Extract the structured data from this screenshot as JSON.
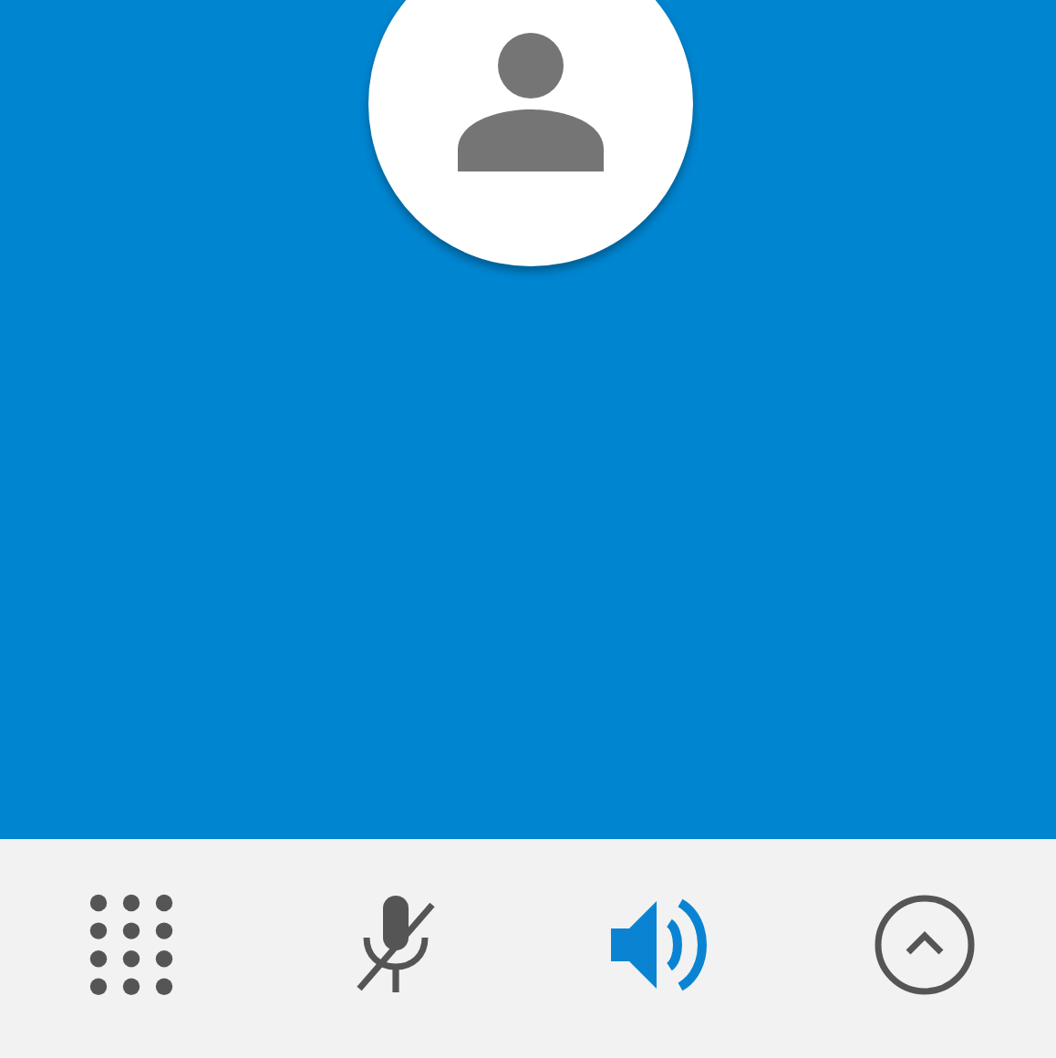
{
  "caller": {
    "kind": "person"
  },
  "controls": [
    {
      "kind": "dialpad",
      "on": false
    },
    {
      "kind": "mute",
      "on": false
    },
    {
      "kind": "speaker",
      "on": true
    },
    {
      "kind": "expand",
      "on": false
    }
  ]
}
